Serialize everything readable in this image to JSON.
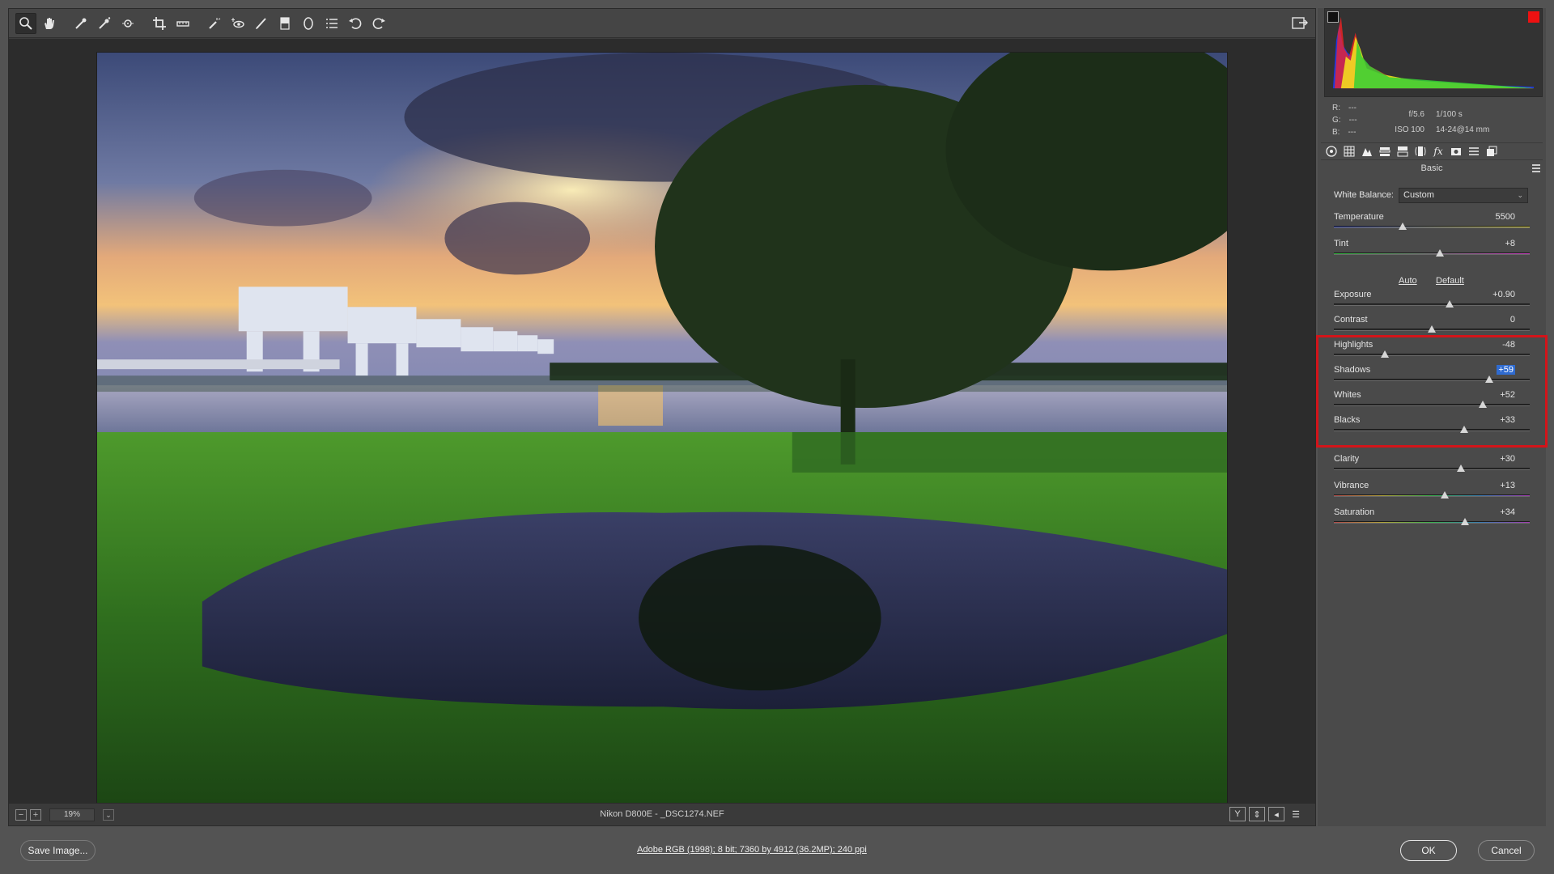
{
  "toolbar": {
    "tools": [
      "zoom-icon",
      "hand-icon",
      "white-balance-icon",
      "color-sampler-icon",
      "target-adjust-icon",
      "crop-icon",
      "straighten-icon",
      "spot-removal-icon",
      "red-eye-icon",
      "adjustment-brush-icon",
      "graduated-filter-icon",
      "radial-filter-icon",
      "presets-icon",
      "rotate-ccw-icon",
      "rotate-cw-icon"
    ]
  },
  "status": {
    "zoom": "19%",
    "filename": "Nikon D800E  -  _DSC1274.NEF"
  },
  "readout": {
    "r_label": "R:",
    "r_val": "---",
    "g_label": "G:",
    "g_val": "---",
    "b_label": "B:",
    "b_val": "---"
  },
  "exif": {
    "aperture": "f/5.6",
    "shutter": "1/100 s",
    "iso": "ISO 100",
    "lens": "14-24@14 mm"
  },
  "panel": {
    "title": "Basic",
    "white_balance_label": "White Balance:",
    "white_balance_value": "Custom",
    "auto": "Auto",
    "default": "Default"
  },
  "sliders": [
    {
      "label": "Temperature",
      "value": "5500",
      "fraction": 0.35
    },
    {
      "label": "Tint",
      "value": "+8",
      "fraction": 0.54
    },
    {
      "label": "Exposure",
      "value": "+0.90",
      "fraction": 0.59
    },
    {
      "label": "Contrast",
      "value": "0",
      "fraction": 0.5
    },
    {
      "label": "Highlights",
      "value": "-48",
      "fraction": 0.26
    },
    {
      "label": "Shadows",
      "value": "+59",
      "fraction": 0.795
    },
    {
      "label": "Whites",
      "value": "+52",
      "fraction": 0.76
    },
    {
      "label": "Blacks",
      "value": "+33",
      "fraction": 0.665
    },
    {
      "label": "Clarity",
      "value": "+30",
      "fraction": 0.65
    },
    {
      "label": "Vibrance",
      "value": "+13",
      "fraction": 0.565
    },
    {
      "label": "Saturation",
      "value": "+34",
      "fraction": 0.67
    }
  ],
  "footer": {
    "save": "Save Image...",
    "workflow": "Adobe RGB (1998); 8 bit; 7360 by 4912 (36.2MP); 240 ppi",
    "ok": "OK",
    "cancel": "Cancel"
  },
  "colors": {
    "highlight_box": "#d3141a",
    "selection": "#2f6bd0"
  }
}
